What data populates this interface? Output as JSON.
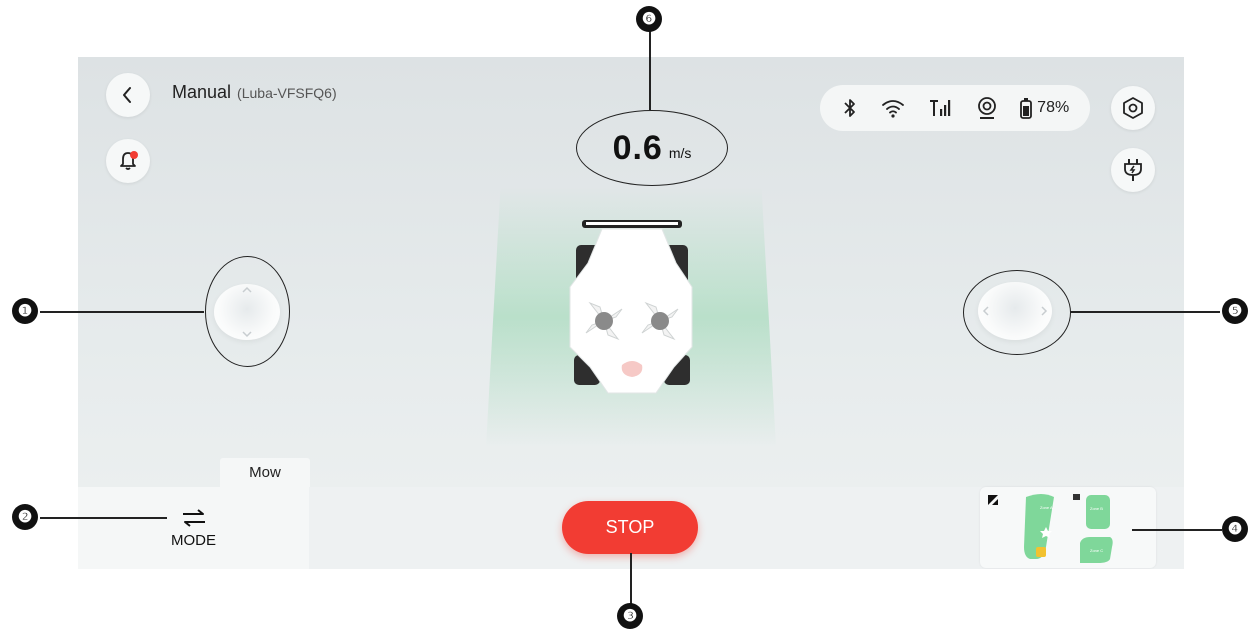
{
  "header": {
    "title": "Manual",
    "device": "(Luba-VFSFQ6)",
    "back_icon": "chevron-left-icon",
    "notification_icon": "bell-icon",
    "notification_dot_color": "#f23c33"
  },
  "status": {
    "icons": [
      "bluetooth-icon",
      "wifi-icon",
      "cellular-signal-icon",
      "camera-icon",
      "battery-icon"
    ],
    "battery_percent": "78%"
  },
  "right_controls": {
    "settings_icon": "settings-hexagon-icon",
    "charge_icon": "plug-icon"
  },
  "speed": {
    "value": "0.6",
    "unit": "m/s"
  },
  "bottom": {
    "mode_tab": "Mow",
    "mode_icon": "swap-arrows-icon",
    "mode_label": "MODE",
    "stop_label": "STOP",
    "stop_color": "#f23c33",
    "map_zone_color": "#7fd79a"
  },
  "callouts": [
    "❶",
    "❷",
    "❸",
    "❹",
    "❺",
    "❻"
  ]
}
